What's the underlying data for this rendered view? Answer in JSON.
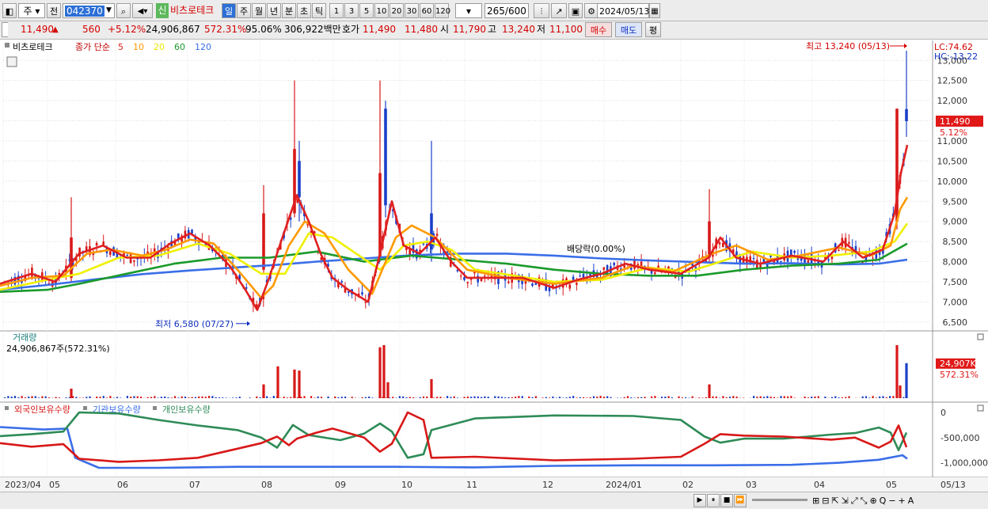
{
  "toolbar": {
    "market": "주",
    "prev_btn": "전",
    "code": "042370",
    "badge": "신",
    "name": "비츠로테크",
    "periods": [
      "일",
      "주",
      "월",
      "년",
      "분",
      "초",
      "틱"
    ],
    "intervals": [
      "1",
      "3",
      "5",
      "10",
      "20",
      "30",
      "60",
      "120"
    ],
    "count": "265",
    "count_max": "/600",
    "date": "2024/05/13"
  },
  "quote": {
    "price": "11,490",
    "up_arrow": "▲",
    "change": "560",
    "change_pct": "+5.12%",
    "volume": "24,906,867",
    "volume_ratio": "572.31%",
    "strength": "95.06%",
    "amount": "306,922백만",
    "ask_label": "호가",
    "ask": "11,490",
    "bid": "11,480",
    "open_label": "시",
    "open": "11,790",
    "high_label": "고",
    "high": "13,240",
    "low_label": "저",
    "low": "11,100",
    "buy_btn": "매수",
    "sell_btn": "매도",
    "eval_btn": "평"
  },
  "legend": {
    "stock": "비츠로테크",
    "ma_label": "종가 단순",
    "ma": [
      {
        "period": "5",
        "color": "#e02020"
      },
      {
        "period": "10",
        "color": "#ff9900"
      },
      {
        "period": "20",
        "color": "#e8e800"
      },
      {
        "period": "60",
        "color": "#1a9a2a"
      },
      {
        "period": "120",
        "color": "#3a6ee8"
      }
    ]
  },
  "volume_panel": {
    "title": "거래량",
    "info": "24,906,867주(572.31%)",
    "last_value": "24,907K",
    "last_ratio": "572.31%"
  },
  "holdings_panel": {
    "series": [
      {
        "name": "외국인보유수량",
        "color": "#d81818"
      },
      {
        "name": "기관보유수량",
        "color": "#3a6ee8"
      },
      {
        "name": "개인보유수량",
        "color": "#2e8b57"
      }
    ],
    "y_labels": [
      "0",
      "-500,000",
      "-1,000,000"
    ]
  },
  "chart_data": {
    "type": "candlestick",
    "y_labels": [
      "13,000",
      "12,500",
      "12,000",
      "11,500",
      "11,000",
      "10,500",
      "10,000",
      "9,500",
      "9,000",
      "8,500",
      "8,000",
      "7,500",
      "7,000",
      "6,500"
    ],
    "ylim": [
      6300,
      13300
    ],
    "x_labels": [
      "2023/04",
      "05",
      "06",
      "07",
      "08",
      "09",
      "10",
      "11",
      "12",
      "2024/01",
      "02",
      "03",
      "04",
      "05",
      "05/13"
    ],
    "lc": "LC:74.62",
    "hc": "HC:-13.22",
    "high_annotation": "최고 13,240 (05/13)",
    "low_annotation": "최저 6,580 (07/27)",
    "dividend_annotation": "배당락(0.00%)",
    "last_price": "11,490",
    "last_change_pct": "5.12%",
    "ma5": [
      [
        0,
        7450
      ],
      [
        40,
        7700
      ],
      [
        70,
        7500
      ],
      [
        100,
        8200
      ],
      [
        130,
        8400
      ],
      [
        160,
        8100
      ],
      [
        190,
        8100
      ],
      [
        215,
        8450
      ],
      [
        240,
        8700
      ],
      [
        265,
        8400
      ],
      [
        290,
        7900
      ],
      [
        310,
        7300
      ],
      [
        325,
        6800
      ],
      [
        340,
        7600
      ],
      [
        355,
        8500
      ],
      [
        375,
        9650
      ],
      [
        390,
        9000
      ],
      [
        405,
        8200
      ],
      [
        420,
        7600
      ],
      [
        440,
        7300
      ],
      [
        465,
        7000
      ],
      [
        480,
        8200
      ],
      [
        495,
        9500
      ],
      [
        510,
        8400
      ],
      [
        530,
        8200
      ],
      [
        550,
        8600
      ],
      [
        570,
        8000
      ],
      [
        590,
        7600
      ],
      [
        620,
        7600
      ],
      [
        660,
        7600
      ],
      [
        700,
        7350
      ],
      [
        730,
        7550
      ],
      [
        760,
        7700
      ],
      [
        790,
        7950
      ],
      [
        820,
        7800
      ],
      [
        860,
        7700
      ],
      [
        895,
        8100
      ],
      [
        910,
        8600
      ],
      [
        930,
        8100
      ],
      [
        960,
        7950
      ],
      [
        1000,
        8150
      ],
      [
        1040,
        8000
      ],
      [
        1065,
        8500
      ],
      [
        1090,
        8100
      ],
      [
        1115,
        8300
      ],
      [
        1130,
        9200
      ],
      [
        1138,
        10200
      ],
      [
        1146,
        10900
      ]
    ],
    "ma10": [
      [
        0,
        7400
      ],
      [
        40,
        7600
      ],
      [
        80,
        7650
      ],
      [
        110,
        8200
      ],
      [
        140,
        8300
      ],
      [
        180,
        8150
      ],
      [
        210,
        8300
      ],
      [
        240,
        8550
      ],
      [
        270,
        8450
      ],
      [
        300,
        7800
      ],
      [
        330,
        7100
      ],
      [
        345,
        7400
      ],
      [
        365,
        8400
      ],
      [
        385,
        9000
      ],
      [
        410,
        8700
      ],
      [
        440,
        7800
      ],
      [
        470,
        7200
      ],
      [
        500,
        8600
      ],
      [
        520,
        8900
      ],
      [
        550,
        8600
      ],
      [
        590,
        7800
      ],
      [
        640,
        7600
      ],
      [
        700,
        7450
      ],
      [
        760,
        7600
      ],
      [
        800,
        7900
      ],
      [
        850,
        7750
      ],
      [
        900,
        8200
      ],
      [
        930,
        8400
      ],
      [
        970,
        8050
      ],
      [
        1010,
        8150
      ],
      [
        1060,
        8350
      ],
      [
        1100,
        8150
      ],
      [
        1125,
        8400
      ],
      [
        1137,
        9300
      ],
      [
        1146,
        9600
      ]
    ],
    "ma20": [
      [
        0,
        7300
      ],
      [
        60,
        7550
      ],
      [
        100,
        7700
      ],
      [
        150,
        8100
      ],
      [
        200,
        8150
      ],
      [
        250,
        8450
      ],
      [
        290,
        8200
      ],
      [
        330,
        7700
      ],
      [
        360,
        7700
      ],
      [
        390,
        8700
      ],
      [
        420,
        8600
      ],
      [
        450,
        8200
      ],
      [
        480,
        7800
      ],
      [
        510,
        8400
      ],
      [
        540,
        8500
      ],
      [
        570,
        8300
      ],
      [
        600,
        7800
      ],
      [
        650,
        7650
      ],
      [
        700,
        7500
      ],
      [
        760,
        7550
      ],
      [
        820,
        7850
      ],
      [
        870,
        7750
      ],
      [
        910,
        8000
      ],
      [
        950,
        8250
      ],
      [
        1000,
        8100
      ],
      [
        1050,
        8150
      ],
      [
        1100,
        8250
      ],
      [
        1130,
        8500
      ],
      [
        1146,
        8950
      ]
    ],
    "ma60": [
      [
        0,
        7250
      ],
      [
        60,
        7300
      ],
      [
        100,
        7450
      ],
      [
        160,
        7700
      ],
      [
        220,
        7950
      ],
      [
        280,
        8100
      ],
      [
        340,
        8100
      ],
      [
        400,
        8250
      ],
      [
        460,
        8000
      ],
      [
        520,
        8150
      ],
      [
        580,
        8050
      ],
      [
        640,
        7950
      ],
      [
        700,
        7800
      ],
      [
        760,
        7700
      ],
      [
        820,
        7650
      ],
      [
        880,
        7650
      ],
      [
        940,
        7800
      ],
      [
        1000,
        7900
      ],
      [
        1060,
        7950
      ],
      [
        1110,
        8050
      ],
      [
        1146,
        8450
      ]
    ],
    "ma120": [
      [
        0,
        7300
      ],
      [
        60,
        7420
      ],
      [
        120,
        7560
      ],
      [
        180,
        7690
      ],
      [
        240,
        7780
      ],
      [
        300,
        7860
      ],
      [
        350,
        7920
      ],
      [
        400,
        8000
      ],
      [
        460,
        8080
      ],
      [
        520,
        8160
      ],
      [
        580,
        8200
      ],
      [
        640,
        8200
      ],
      [
        700,
        8150
      ],
      [
        760,
        8080
      ],
      [
        820,
        8030
      ],
      [
        880,
        7990
      ],
      [
        940,
        7950
      ],
      [
        1000,
        7960
      ],
      [
        1060,
        7930
      ],
      [
        1110,
        7950
      ],
      [
        1146,
        8050
      ]
    ],
    "candle_highlights": [
      {
        "x": 90,
        "o": 7600,
        "c": 8600,
        "h": 9600,
        "l": 7500
      },
      {
        "x": 333,
        "o": 7800,
        "c": 9200,
        "h": 9900,
        "l": 7700
      },
      {
        "x": 372,
        "o": 9200,
        "c": 10800,
        "h": 12500,
        "l": 9100
      },
      {
        "x": 378,
        "o": 10500,
        "c": 9600,
        "h": 11000,
        "l": 9000
      },
      {
        "x": 480,
        "o": 8100,
        "c": 10200,
        "h": 12500,
        "l": 8000
      },
      {
        "x": 487,
        "o": 11800,
        "c": 9400,
        "h": 12000,
        "l": 9100
      },
      {
        "x": 545,
        "o": 9200,
        "c": 8300,
        "h": 11000,
        "l": 8000
      },
      {
        "x": 896,
        "o": 8100,
        "c": 9000,
        "h": 9800,
        "l": 8000
      },
      {
        "x": 1133,
        "o": 9000,
        "c": 11800,
        "h": 11800,
        "l": 8800
      },
      {
        "x": 1145,
        "o": 11790,
        "c": 11490,
        "h": 13240,
        "l": 11100
      }
    ],
    "volume_highlights": [
      {
        "x": 90,
        "v": 9
      },
      {
        "x": 333,
        "v": 13
      },
      {
        "x": 351,
        "v": 30
      },
      {
        "x": 372,
        "v": 27
      },
      {
        "x": 378,
        "v": 26
      },
      {
        "x": 480,
        "v": 48
      },
      {
        "x": 485,
        "v": 50
      },
      {
        "x": 490,
        "v": 15
      },
      {
        "x": 545,
        "v": 18
      },
      {
        "x": 896,
        "v": 13
      },
      {
        "x": 1133,
        "v": 50
      },
      {
        "x": 1137,
        "v": 12
      },
      {
        "x": 1145,
        "v": 33
      }
    ],
    "foreign": [
      [
        0,
        -610000
      ],
      [
        40,
        -680000
      ],
      [
        80,
        -630000
      ],
      [
        100,
        -920000
      ],
      [
        150,
        -980000
      ],
      [
        200,
        -950000
      ],
      [
        250,
        -900000
      ],
      [
        300,
        -720000
      ],
      [
        330,
        -610000
      ],
      [
        350,
        -480000
      ],
      [
        365,
        -650000
      ],
      [
        375,
        -520000
      ],
      [
        400,
        -400000
      ],
      [
        420,
        -320000
      ],
      [
        460,
        -500000
      ],
      [
        480,
        -780000
      ],
      [
        495,
        -620000
      ],
      [
        515,
        0
      ],
      [
        535,
        -150000
      ],
      [
        545,
        -900000
      ],
      [
        600,
        -880000
      ],
      [
        700,
        -950000
      ],
      [
        800,
        -920000
      ],
      [
        860,
        -880000
      ],
      [
        890,
        -620000
      ],
      [
        910,
        -430000
      ],
      [
        940,
        -460000
      ],
      [
        990,
        -480000
      ],
      [
        1050,
        -540000
      ],
      [
        1080,
        -500000
      ],
      [
        1110,
        -700000
      ],
      [
        1125,
        -580000
      ],
      [
        1135,
        -260000
      ],
      [
        1145,
        -690000
      ]
    ],
    "institution": [
      [
        0,
        -290000
      ],
      [
        55,
        -340000
      ],
      [
        85,
        -320000
      ],
      [
        95,
        -900000
      ],
      [
        125,
        -1100000
      ],
      [
        200,
        -1100000
      ],
      [
        300,
        -1080000
      ],
      [
        400,
        -1080000
      ],
      [
        500,
        -1080000
      ],
      [
        600,
        -1090000
      ],
      [
        700,
        -1060000
      ],
      [
        800,
        -1050000
      ],
      [
        900,
        -1050000
      ],
      [
        1000,
        -1040000
      ],
      [
        1060,
        -1000000
      ],
      [
        1110,
        -940000
      ],
      [
        1140,
        -850000
      ],
      [
        1146,
        -920000
      ]
    ],
    "individual": [
      [
        0,
        -470000
      ],
      [
        40,
        -430000
      ],
      [
        80,
        -380000
      ],
      [
        100,
        0
      ],
      [
        150,
        -20000
      ],
      [
        200,
        -150000
      ],
      [
        250,
        -260000
      ],
      [
        300,
        -350000
      ],
      [
        330,
        -500000
      ],
      [
        350,
        -700000
      ],
      [
        370,
        -250000
      ],
      [
        390,
        -450000
      ],
      [
        430,
        -550000
      ],
      [
        460,
        -420000
      ],
      [
        480,
        -220000
      ],
      [
        495,
        -380000
      ],
      [
        515,
        -900000
      ],
      [
        535,
        -830000
      ],
      [
        545,
        -350000
      ],
      [
        600,
        -120000
      ],
      [
        700,
        -60000
      ],
      [
        800,
        -70000
      ],
      [
        860,
        -150000
      ],
      [
        890,
        -480000
      ],
      [
        910,
        -600000
      ],
      [
        940,
        -520000
      ],
      [
        990,
        -520000
      ],
      [
        1050,
        -440000
      ],
      [
        1080,
        -410000
      ],
      [
        1110,
        -300000
      ],
      [
        1125,
        -400000
      ],
      [
        1135,
        -750000
      ],
      [
        1145,
        -400000
      ]
    ]
  },
  "footer": {
    "nav": [
      "▶",
      "⏸",
      "■",
      "⏩"
    ]
  }
}
